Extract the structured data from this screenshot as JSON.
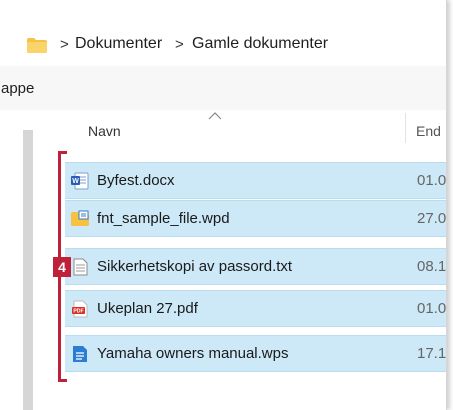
{
  "breadcrumb": {
    "separator": ">",
    "items": [
      "Dokumenter",
      "Gamle dokumenter"
    ]
  },
  "toolbar": {
    "partial_label": "appe"
  },
  "columns": {
    "name": "Navn",
    "date_partial": "End"
  },
  "files": [
    {
      "name": "Byfest.docx",
      "date": "01.0",
      "icon": "word-doc-icon"
    },
    {
      "name": "fnt_sample_file.wpd",
      "date": "27.0",
      "icon": "wpd-file-icon"
    },
    {
      "name": "Sikkerhetskopi av passord.txt",
      "date": "08.1",
      "icon": "text-file-icon"
    },
    {
      "name": "Ukeplan 27.pdf",
      "date": "01.0",
      "icon": "pdf-file-icon"
    },
    {
      "name": "Yamaha owners manual.wps",
      "date": "17.1",
      "icon": "wps-file-icon"
    }
  ],
  "annotation": {
    "badge": "4"
  },
  "colors": {
    "selection": "#cde8f6",
    "annotation": "#c0213a",
    "folder": "#f5c242"
  }
}
